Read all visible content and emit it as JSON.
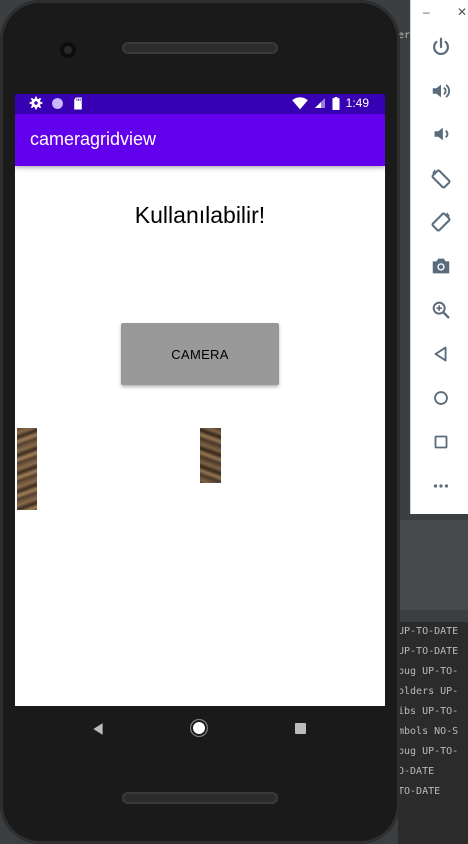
{
  "emulator": {
    "window_controls": [
      "–",
      "✕"
    ],
    "tools": [
      {
        "icon": "power-icon"
      },
      {
        "icon": "volume-up-icon"
      },
      {
        "icon": "volume-down-icon"
      },
      {
        "icon": "rotate-left-icon"
      },
      {
        "icon": "rotate-right-icon"
      },
      {
        "icon": "camera-icon"
      },
      {
        "icon": "zoom-icon"
      },
      {
        "icon": "back-icon"
      },
      {
        "icon": "home-icon"
      },
      {
        "icon": "overview-icon"
      },
      {
        "icon": "more-icon"
      }
    ]
  },
  "ide": {
    "top_fragment": "er",
    "log_lines": [
      "UP-TO-DATE",
      "UP-TO-DATE",
      "bug UP-TO-",
      "olders UP-",
      "ibs UP-TO-",
      "mbols NO-S",
      "bug UP-TO-",
      "O-DATE",
      "TO-DATE"
    ]
  },
  "status_bar": {
    "time": "1:49"
  },
  "app": {
    "title": "cameragridview",
    "status_text": "Kullanılabilir!",
    "camera_button": "CAMERA"
  },
  "colors": {
    "status_bar": "#3700b3",
    "app_bar": "#6200ee",
    "button": "#999999"
  }
}
